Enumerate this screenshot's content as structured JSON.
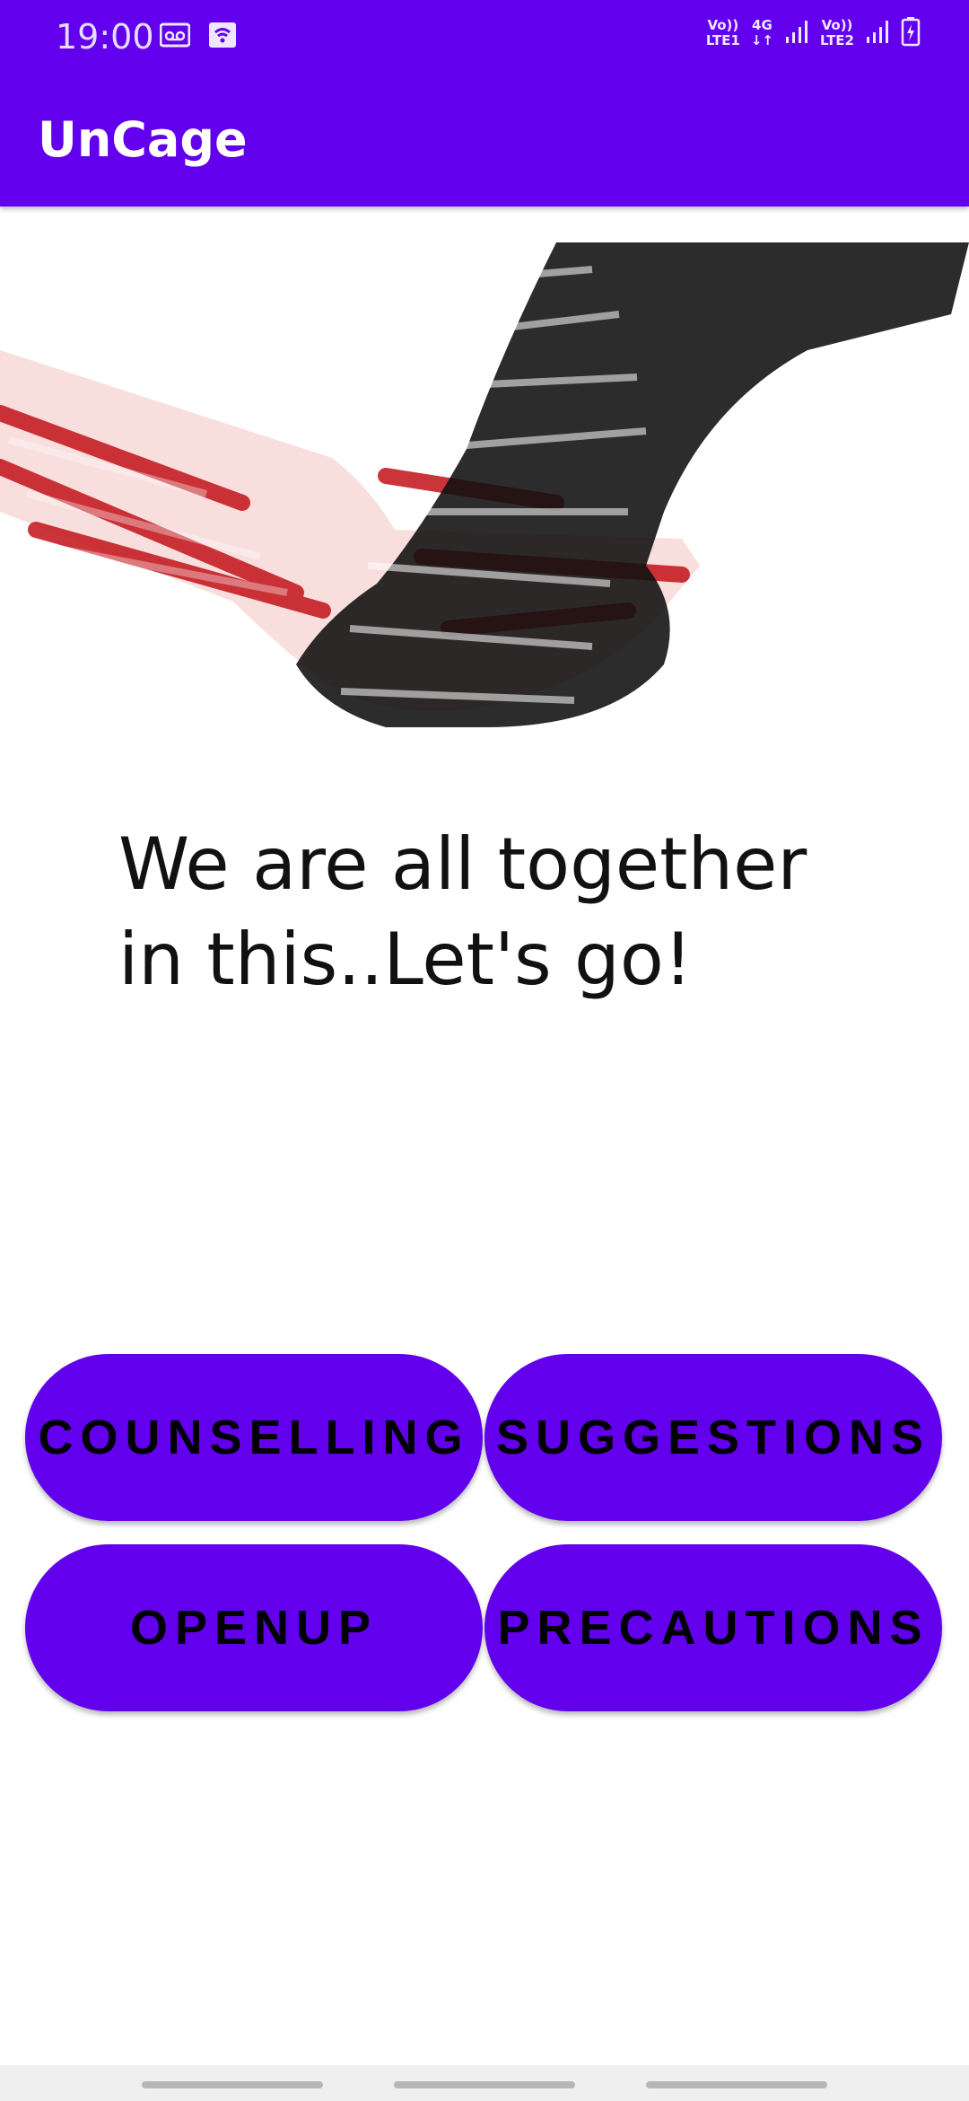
{
  "status_bar": {
    "time": "19:00",
    "sim1": {
      "top": "Vo))",
      "bottom": "LTE1",
      "net": "4G"
    },
    "sim2": {
      "top": "Vo))",
      "bottom": "LTE2"
    }
  },
  "app_bar": {
    "title": "UnCage"
  },
  "hero": {
    "alt": "Two hands holding, made of supportive words"
  },
  "main": {
    "tagline_line1": "We are all together",
    "tagline_line2": "in this..Let's go!"
  },
  "buttons": {
    "counselling": "COUNSELLING",
    "suggestions": "SUGGESTIONS",
    "openup": "OPENUP",
    "precautions": "PRECAUTIONS"
  },
  "colors": {
    "primary": "#6200EE",
    "background": "#FFFFFF",
    "button_text": "#000000"
  }
}
